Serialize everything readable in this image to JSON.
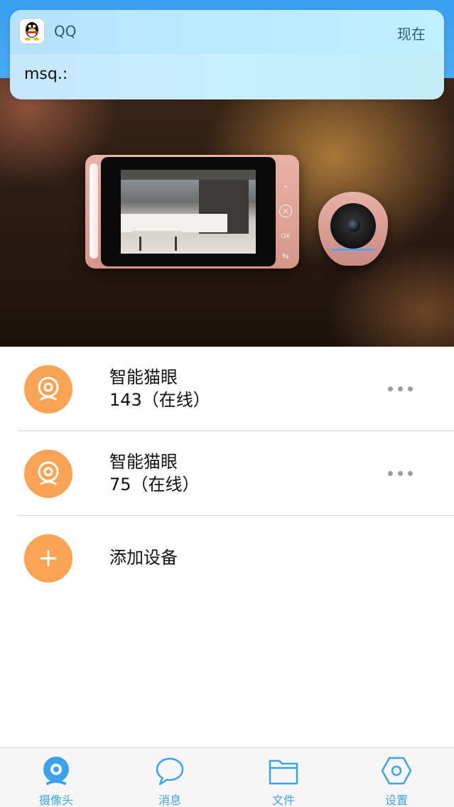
{
  "notification": {
    "app_name": "QQ",
    "time": "现在",
    "message": "msq.:"
  },
  "devices": [
    {
      "name": "智能猫眼",
      "status": "143（在线）"
    },
    {
      "name": "智能猫眼",
      "status": "75（在线）"
    }
  ],
  "add_device": {
    "label": "添加设备"
  },
  "tabs": [
    {
      "label": "摄像头",
      "icon": "camera-icon"
    },
    {
      "label": "消息",
      "icon": "chat-bubble-icon"
    },
    {
      "label": "文件",
      "icon": "folder-icon"
    },
    {
      "label": "设置",
      "icon": "settings-hexagon-icon"
    }
  ],
  "colors": {
    "accent": "#3ba3ee",
    "device_icon_bg": "#fba354",
    "more_dots": "#9b9b9b"
  }
}
